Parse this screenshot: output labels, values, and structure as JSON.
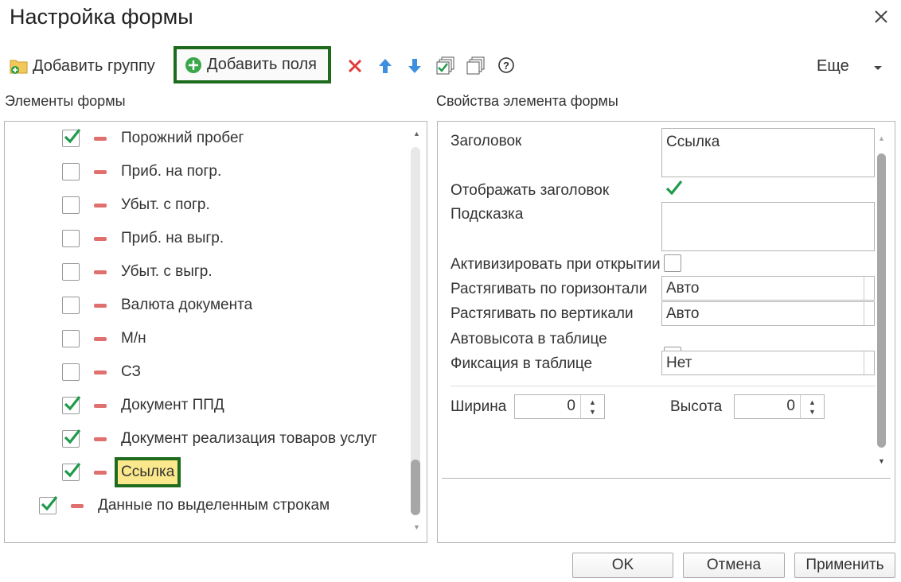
{
  "window": {
    "title": "Настройка формы"
  },
  "toolbar": {
    "add_group": "Добавить группу",
    "add_fields": "Добавить поля",
    "more": "Еще"
  },
  "left_panel": {
    "title": "Элементы формы",
    "items": [
      {
        "label": "Порожний пробег",
        "checked": true
      },
      {
        "label": "Приб. на погр.",
        "checked": false
      },
      {
        "label": "Убыт. с погр.",
        "checked": false
      },
      {
        "label": "Приб. на выгр.",
        "checked": false
      },
      {
        "label": "Убыт. с выгр.",
        "checked": false
      },
      {
        "label": "Валюта документа",
        "checked": false
      },
      {
        "label": "М/н",
        "checked": false
      },
      {
        "label": "СЗ",
        "checked": false
      },
      {
        "label": "Документ ППД",
        "checked": true
      },
      {
        "label": "Документ реализация товаров услуг",
        "checked": true
      },
      {
        "label": "Ссылка",
        "checked": true,
        "selected": true
      },
      {
        "label": "Данные по выделенным строкам",
        "checked": true
      }
    ]
  },
  "right_panel": {
    "title": "Свойства элемента формы",
    "header_label": "Заголовок",
    "header_value": "Ссылка",
    "show_header_label": "Отображать заголовок",
    "show_header_checked": true,
    "hint_label": "Подсказка",
    "hint_value": "",
    "activate_label": "Активизировать при открытии",
    "activate_checked": false,
    "stretch_h_label": "Растягивать по горизонтали",
    "stretch_h_value": "Авто",
    "stretch_v_label": "Растягивать по вертикали",
    "stretch_v_value": "Авто",
    "autoheight_label": "Автовысота в таблице",
    "autoheight_checked": false,
    "fix_label": "Фиксация в таблице",
    "fix_value": "Нет",
    "width_label": "Ширина",
    "width_value": "0",
    "height_label": "Высота",
    "height_value": "0"
  },
  "footer": {
    "ok": "OK",
    "cancel": "Отмена",
    "apply": "Применить"
  },
  "colors": {
    "accent_green": "#1e6b1e",
    "check_green": "#1f9a4a",
    "highlight": "#fbe88c",
    "minus_red": "#e0706e"
  }
}
